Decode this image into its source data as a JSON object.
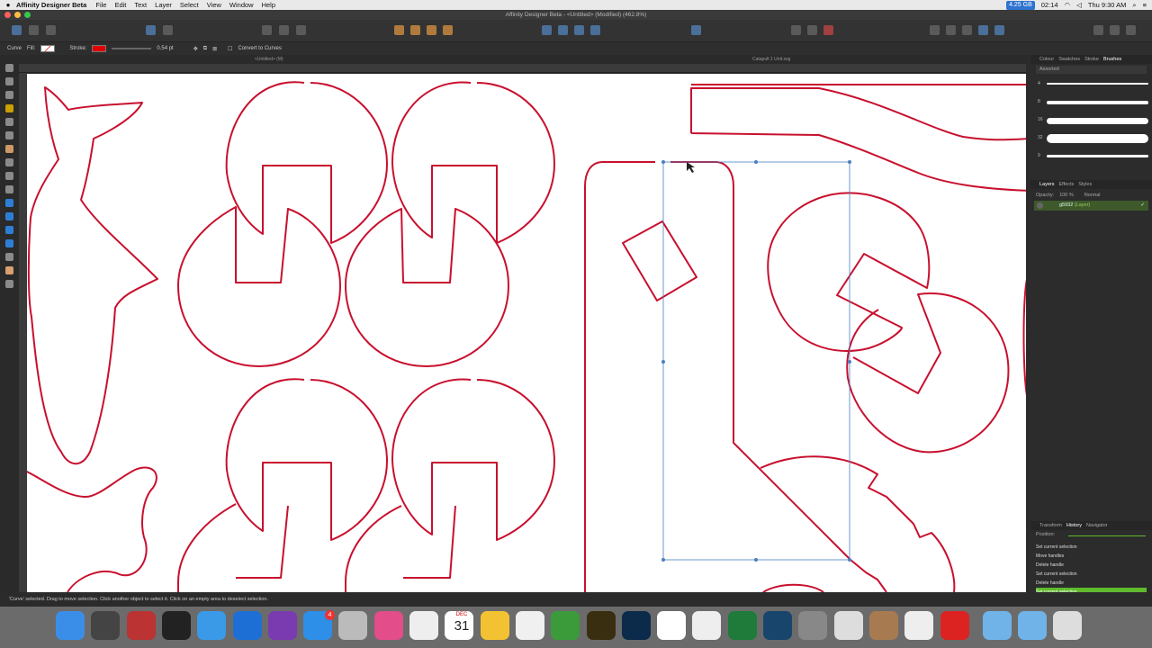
{
  "menubar": {
    "app_name": "Affinity Designer Beta",
    "items": [
      "File",
      "Edit",
      "Text",
      "Layer",
      "Select",
      "View",
      "Window",
      "Help"
    ],
    "memory": "4.25 GB",
    "time_small": "02:14",
    "clock": "Thu 9:30 AM"
  },
  "window": {
    "title": "Affinity Designer Beta - <Untitled> (Modified) (462.8%)"
  },
  "context_toolbar": {
    "tool": "Curve",
    "fill_label": "Fill:",
    "stroke_label": "Stroke:",
    "stroke_width": "0.54 pt",
    "convert_label": "Convert to Curves",
    "stroke_color": "#e00000"
  },
  "document": {
    "tab": "<Untitled> (M)",
    "artboard": "Catapult 1 Unit.svg"
  },
  "panels": {
    "top_tabs": [
      "Colour",
      "Swatches",
      "Stroke",
      "Brushes"
    ],
    "brush_category": "Assorted",
    "brush_sizes": [
      "4",
      "8",
      "16",
      "32",
      "9"
    ],
    "layer_tabs": [
      "Layers",
      "Effects",
      "Styles"
    ],
    "opacity": "100 %",
    "opacity_label": "Opacity:",
    "blend_mode": "Normal",
    "layer_name": "g5932",
    "layer_kind": "(Layer)",
    "bottom_tabs": [
      "Transform",
      "History",
      "Navigator"
    ],
    "history_label": "Position:",
    "history": [
      "Set current selection",
      "Move handles",
      "Delete handle",
      "Set current selection",
      "Delete handle",
      "Set current selection"
    ]
  },
  "status_text": "'Curve' selected. Drag to move selection. Click another object to select it. Click on an empty area to deselect selection.",
  "dock": {
    "calendar_month": "DEC",
    "calendar_day": "31",
    "appstore_badge": "4",
    "items": [
      "finder-icon",
      "launchpad-icon",
      "photo-booth-icon",
      "dashboard-icon",
      "safari-icon",
      "affinity-designer-icon",
      "affinity-designer-beta-icon",
      "app-store-icon",
      "preview-icon",
      "itunes-icon",
      "notes-icon",
      "calendar-icon",
      "photos-icon",
      "pages-icon",
      "numbers-icon",
      "illustrator-icon",
      "photoshop-icon",
      "acrobat-icon",
      "acrobat-reader-icon",
      "excel-icon",
      "steam-icon",
      "system-preferences-icon",
      "printer-icon",
      "migration-icon",
      "archive-utility-icon",
      "opera-icon",
      "folder-icon",
      "downloads-folder-icon",
      "trash-icon"
    ]
  },
  "colors": {
    "cut_line": "#c8102e",
    "selection": "#4a7fc0",
    "accent_green": "#5fba2e"
  }
}
